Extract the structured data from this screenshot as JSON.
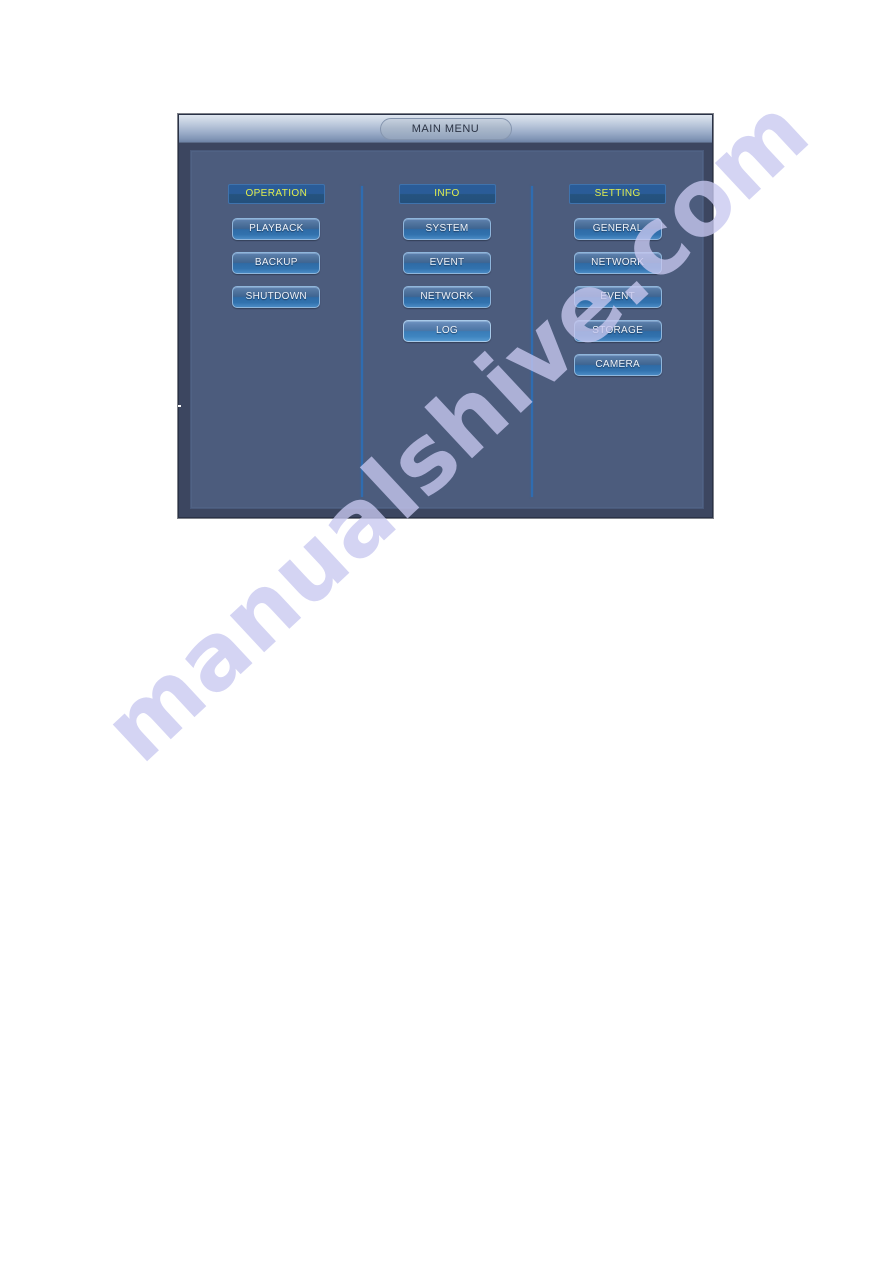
{
  "window": {
    "title": "MAIN MENU"
  },
  "colors": {
    "accent_header_text": "#e0ee4e",
    "button_text": "#eef4fb",
    "panel_background": "#4c5c7d",
    "dialog_background": "#3c4660",
    "divider": "#2f6cb0",
    "titlebar_text": "#2b3344",
    "watermark": "#c8c8f0"
  },
  "watermark": {
    "text": "manualshive.com"
  },
  "columns": [
    {
      "header": "OPERATION",
      "items": [
        {
          "label": "PLAYBACK",
          "highlighted": false
        },
        {
          "label": "BACKUP",
          "highlighted": false
        },
        {
          "label": "SHUTDOWN",
          "highlighted": false
        }
      ]
    },
    {
      "header": "INFO",
      "items": [
        {
          "label": "SYSTEM",
          "highlighted": false
        },
        {
          "label": "EVENT",
          "highlighted": false
        },
        {
          "label": "NETWORK",
          "highlighted": false
        },
        {
          "label": "LOG",
          "highlighted": true
        }
      ]
    },
    {
      "header": "SETTING",
      "items": [
        {
          "label": "GENERAL",
          "highlighted": false
        },
        {
          "label": "NETWORK",
          "highlighted": false
        },
        {
          "label": "EVENT",
          "highlighted": false
        },
        {
          "label": "STORAGE",
          "highlighted": false
        },
        {
          "label": "CAMERA",
          "highlighted": false
        }
      ]
    }
  ]
}
